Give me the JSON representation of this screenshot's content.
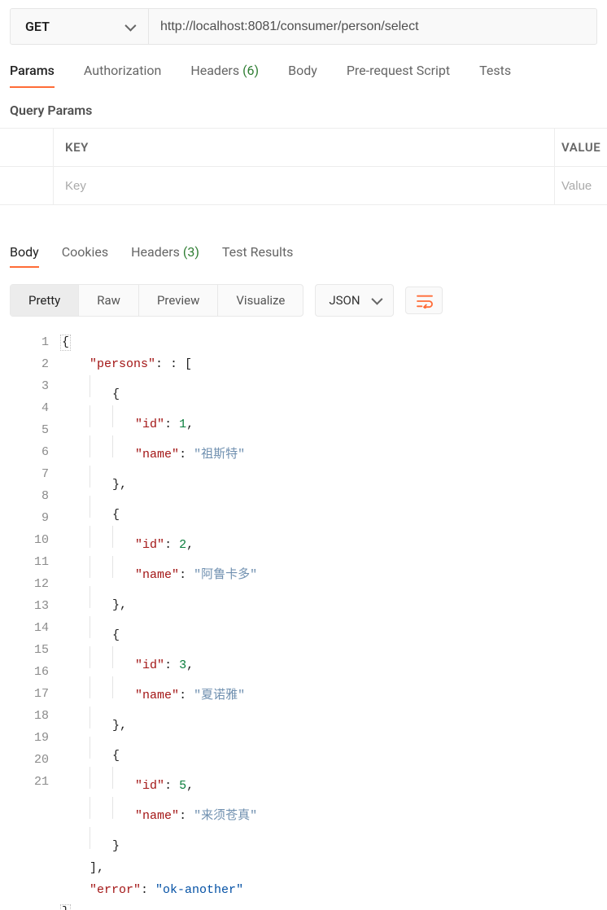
{
  "request": {
    "method": "GET",
    "url": "http://localhost:8081/consumer/person/select"
  },
  "request_tabs": {
    "params": "Params",
    "authorization": "Authorization",
    "headers_label": "Headers",
    "headers_count": "(6)",
    "body": "Body",
    "pre_request": "Pre-request Script",
    "tests": "Tests"
  },
  "query_params": {
    "title": "Query Params",
    "key_header": "KEY",
    "value_header": "VALUE",
    "key_placeholder": "Key",
    "value_placeholder": "Value"
  },
  "response_tabs": {
    "body": "Body",
    "cookies": "Cookies",
    "headers_label": "Headers",
    "headers_count": "(3)",
    "test_results": "Test Results"
  },
  "view_modes": {
    "pretty": "Pretty",
    "raw": "Raw",
    "preview": "Preview",
    "visualize": "Visualize"
  },
  "lang": "JSON",
  "json_body": {
    "persons": [
      {
        "id": 1,
        "name": "祖斯特"
      },
      {
        "id": 2,
        "name": "阿鲁卡多"
      },
      {
        "id": 3,
        "name": "夏诺雅"
      },
      {
        "id": 5,
        "name": "来须苍真"
      }
    ],
    "error": "ok-another"
  },
  "code_lines": [
    {
      "n": 1,
      "indent": 0,
      "bracebox": "{"
    },
    {
      "n": 2,
      "indent": 1,
      "key": "persons",
      "after": ": ["
    },
    {
      "n": 3,
      "indent": 2,
      "guides": 1,
      "txt": "{"
    },
    {
      "n": 4,
      "indent": 3,
      "guides": 2,
      "key": "id",
      "num": 1,
      "comma": true
    },
    {
      "n": 5,
      "indent": 3,
      "guides": 2,
      "key": "name",
      "str": "祖斯特",
      "zh": true
    },
    {
      "n": 6,
      "indent": 2,
      "guides": 1,
      "txt": "},"
    },
    {
      "n": 7,
      "indent": 2,
      "guides": 1,
      "txt": "{"
    },
    {
      "n": 8,
      "indent": 3,
      "guides": 2,
      "key": "id",
      "num": 2,
      "comma": true
    },
    {
      "n": 9,
      "indent": 3,
      "guides": 2,
      "key": "name",
      "str": "阿鲁卡多",
      "zh": true
    },
    {
      "n": 10,
      "indent": 2,
      "guides": 1,
      "txt": "},"
    },
    {
      "n": 11,
      "indent": 2,
      "guides": 1,
      "txt": "{"
    },
    {
      "n": 12,
      "indent": 3,
      "guides": 2,
      "key": "id",
      "num": 3,
      "comma": true
    },
    {
      "n": 13,
      "indent": 3,
      "guides": 2,
      "key": "name",
      "str": "夏诺雅",
      "zh": true
    },
    {
      "n": 14,
      "indent": 2,
      "guides": 1,
      "txt": "},"
    },
    {
      "n": 15,
      "indent": 2,
      "guides": 1,
      "txt": "{"
    },
    {
      "n": 16,
      "indent": 3,
      "guides": 2,
      "key": "id",
      "num": 5,
      "comma": true
    },
    {
      "n": 17,
      "indent": 3,
      "guides": 2,
      "key": "name",
      "str": "来须苍真",
      "zh": true
    },
    {
      "n": 18,
      "indent": 2,
      "guides": 1,
      "txt": "}"
    },
    {
      "n": 19,
      "indent": 1,
      "txt": "],"
    },
    {
      "n": 20,
      "indent": 1,
      "key": "error",
      "str": "ok-another"
    },
    {
      "n": 21,
      "indent": 0,
      "bracebox": "}"
    }
  ]
}
